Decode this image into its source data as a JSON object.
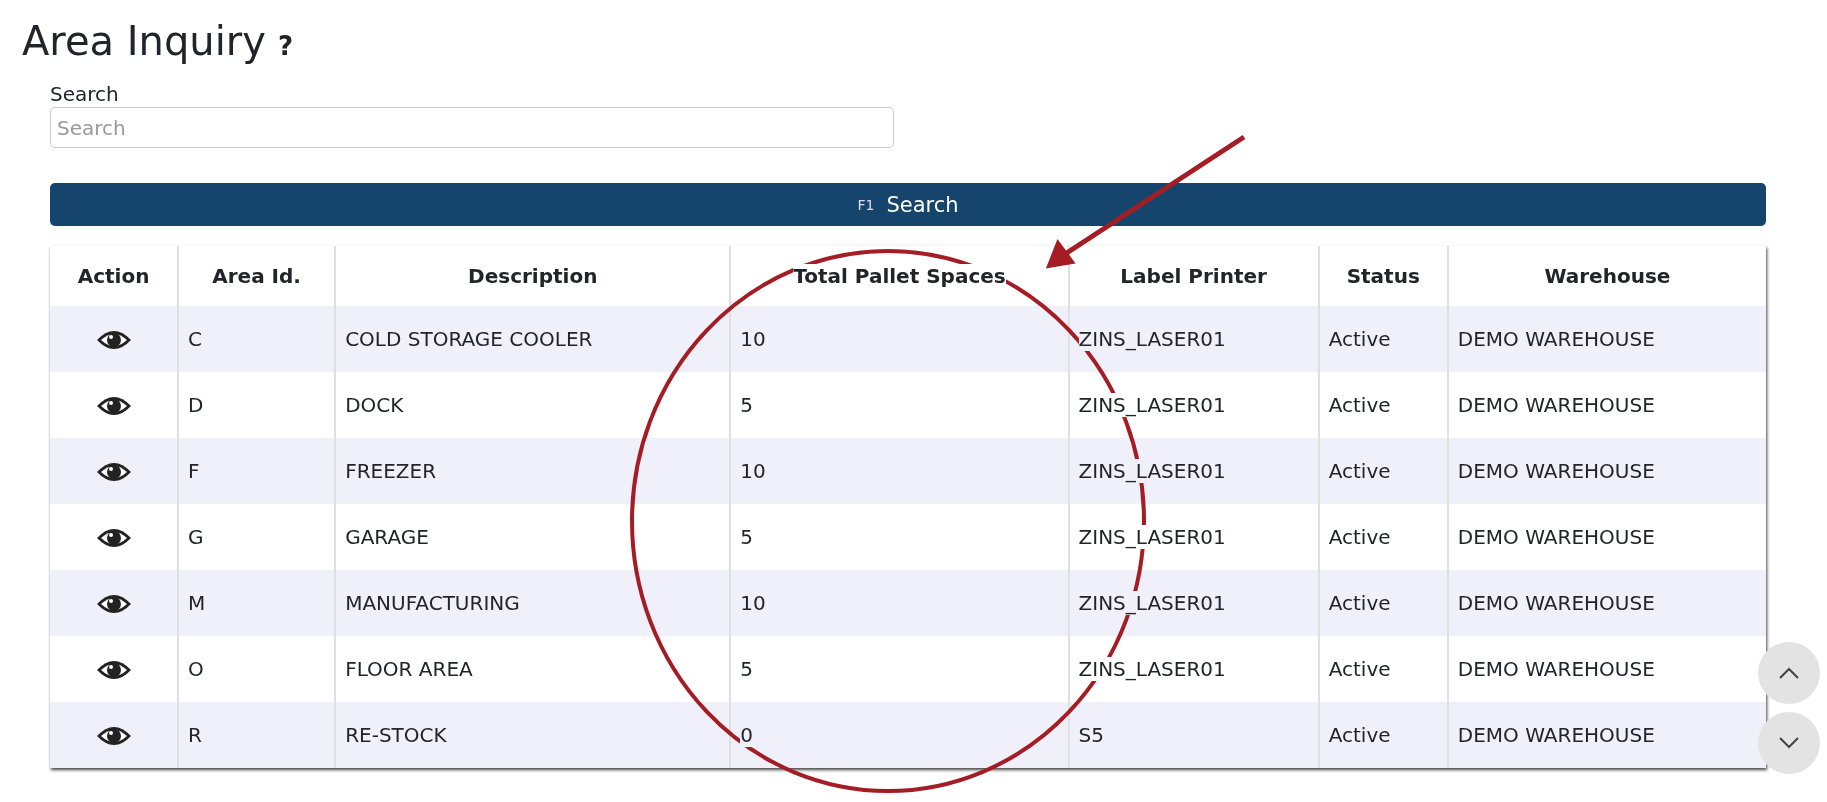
{
  "page": {
    "title": "Area Inquiry",
    "help": "?"
  },
  "search": {
    "label": "Search",
    "placeholder": "Search"
  },
  "search_button": {
    "shortcut": "F1",
    "label": "Search"
  },
  "table": {
    "columns": [
      "Action",
      "Area Id.",
      "Description",
      "Total Pallet Spaces",
      "Label Printer",
      "Status",
      "Warehouse"
    ],
    "rows": [
      {
        "area_id": "C",
        "description": "COLD STORAGE COOLER",
        "total_pallet_spaces": "10",
        "label_printer": "ZINS_LASER01",
        "status": "Active",
        "warehouse": "DEMO WAREHOUSE"
      },
      {
        "area_id": "D",
        "description": "DOCK",
        "total_pallet_spaces": "5",
        "label_printer": "ZINS_LASER01",
        "status": "Active",
        "warehouse": "DEMO WAREHOUSE"
      },
      {
        "area_id": "F",
        "description": "FREEZER",
        "total_pallet_spaces": "10",
        "label_printer": "ZINS_LASER01",
        "status": "Active",
        "warehouse": "DEMO WAREHOUSE"
      },
      {
        "area_id": "G",
        "description": "GARAGE",
        "total_pallet_spaces": "5",
        "label_printer": "ZINS_LASER01",
        "status": "Active",
        "warehouse": "DEMO WAREHOUSE"
      },
      {
        "area_id": "M",
        "description": "MANUFACTURING",
        "total_pallet_spaces": "10",
        "label_printer": "ZINS_LASER01",
        "status": "Active",
        "warehouse": "DEMO WAREHOUSE"
      },
      {
        "area_id": "O",
        "description": "FLOOR AREA",
        "total_pallet_spaces": "5",
        "label_printer": "ZINS_LASER01",
        "status": "Active",
        "warehouse": "DEMO WAREHOUSE"
      },
      {
        "area_id": "R",
        "description": "RE-STOCK",
        "total_pallet_spaces": "0",
        "label_printer": "S5",
        "status": "Active",
        "warehouse": "DEMO WAREHOUSE"
      }
    ]
  }
}
